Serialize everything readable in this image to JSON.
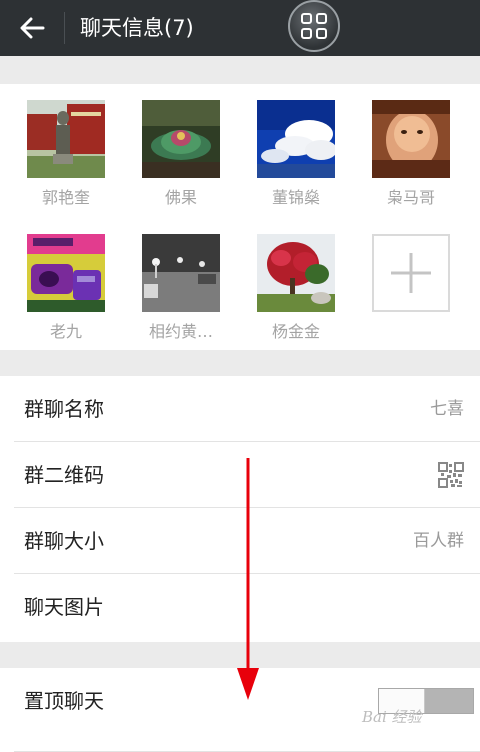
{
  "header": {
    "title": "聊天信息(7)",
    "back_icon": "back-arrow-icon",
    "float_menu_icon": "grid-menu-icon",
    "background": "#2d3134"
  },
  "members": [
    {
      "name": "郭艳奎",
      "avatar": "statue-photo"
    },
    {
      "name": "佛果",
      "avatar": "lotus-photo"
    },
    {
      "name": "董锦燊",
      "avatar": "sky-clouds-photo"
    },
    {
      "name": "枭马哥",
      "avatar": "face-photo"
    },
    {
      "name": "老九",
      "avatar": "purple-card-photo"
    },
    {
      "name": "相约黄…",
      "avatar": "night-street-photo"
    },
    {
      "name": "杨金金",
      "avatar": "red-tree-photo"
    }
  ],
  "add_member_icon": "plus-icon",
  "group": {
    "name_label": "群聊名称",
    "name_value": "七喜",
    "qrcode_label": "群二维码",
    "qrcode_icon": "qr-code-icon",
    "size_label": "群聊大小",
    "size_value": "百人群",
    "images_label": "聊天图片"
  },
  "pin": {
    "label": "置顶聊天",
    "enabled": false
  },
  "watermark": "Bai 经验",
  "annotation_arrow_color": "#e8000b"
}
